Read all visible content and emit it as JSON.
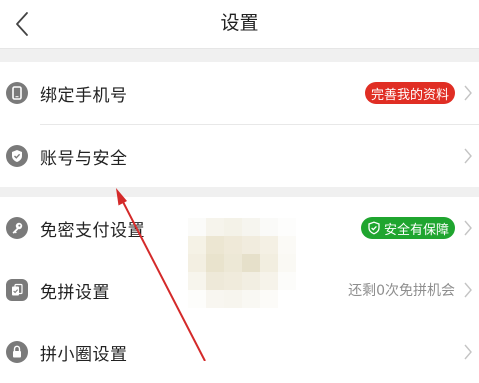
{
  "header": {
    "title": "设置"
  },
  "rows": [
    {
      "label": "绑定手机号",
      "badge": "完善我的资料"
    },
    {
      "label": "账号与安全"
    },
    {
      "label": "免密支付设置",
      "badge": "安全有保障"
    },
    {
      "label": "免拼设置",
      "note": "还剩0次免拼机会"
    },
    {
      "label": "拼小圈设置"
    }
  ],
  "colors": {
    "red_badge": "#e02e24",
    "green_badge": "#1fa52f",
    "icon_gray": "#7a7a7a",
    "annotation_arrow": "#d42a2a"
  }
}
